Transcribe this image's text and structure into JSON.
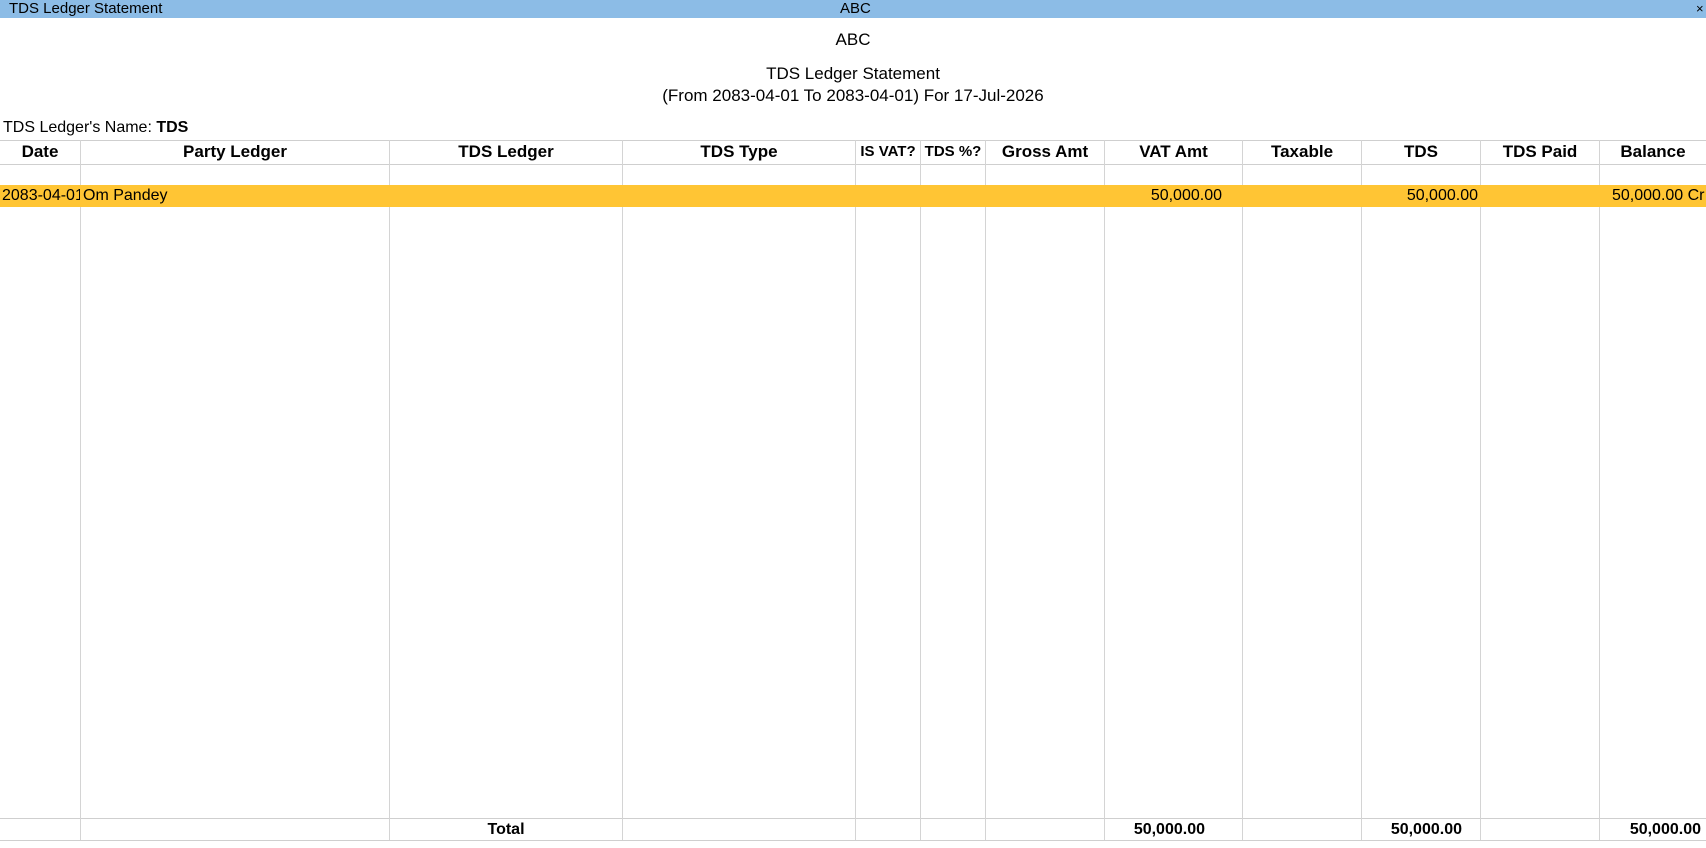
{
  "window": {
    "title": "TDS Ledger Statement",
    "company": "ABC",
    "close_glyph": "×"
  },
  "report": {
    "company": "ABC",
    "title": "TDS Ledger Statement",
    "period": "(From 2083-04-01 To 2083-04-01) For 17-Jul-2026"
  },
  "ledger": {
    "label": "TDS Ledger's Name:",
    "name": "TDS"
  },
  "columns": [
    "Date",
    "Party Ledger",
    "TDS Ledger",
    "TDS Type",
    "IS VAT?",
    "TDS %?",
    "Gross Amt",
    "VAT Amt",
    "Taxable",
    "TDS",
    "TDS Paid",
    "Balance"
  ],
  "rows": [
    {
      "date": "2083-04-01",
      "party_ledger": "Om Pandey",
      "tds_ledger": "",
      "tds_type": "",
      "is_vat": "",
      "tds_pct": "",
      "gross_amt": "",
      "vat_amt": "50,000.00",
      "taxable": "",
      "tds": "50,000.00",
      "tds_paid": "",
      "balance": "50,000.00 Cr"
    }
  ],
  "totals": {
    "label": "Total",
    "vat_amt": "50,000.00",
    "tds": "50,000.00",
    "balance": "50,000.00"
  },
  "colors": {
    "titlebar": "#8cbce6",
    "selected_row": "#ffc534",
    "grid_line": "#d4d4d4"
  }
}
